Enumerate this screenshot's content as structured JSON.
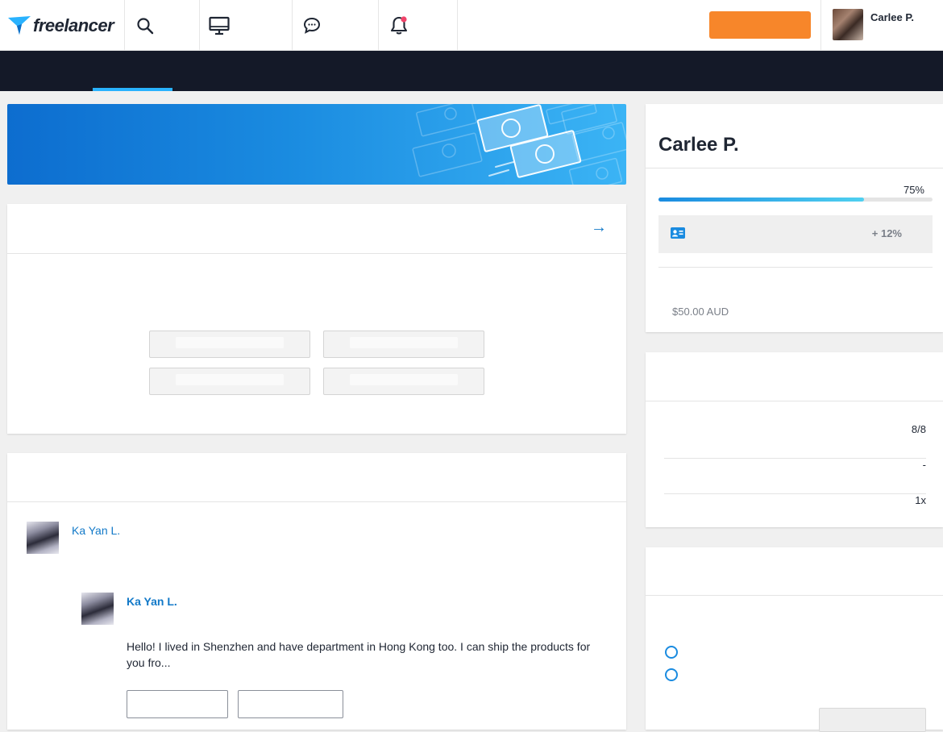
{
  "header": {
    "logo_text": "freelancer",
    "user": {
      "name": "Carlee P."
    },
    "notification_dot_color": "#f0436a",
    "post_button_color": "#f7862a"
  },
  "subnav": {
    "active_indicator_color": "#29b2fe"
  },
  "proposal": {
    "arrow": "→"
  },
  "bids": {
    "bidder_name": "Ka Yan L.",
    "reply_author": "Ka Yan L.",
    "reply_text": "Hello! I lived in Shenzhen and have department in Hong Kong too. I can ship the products for you fro..."
  },
  "profile": {
    "name": "Carlee P.",
    "progress_label": "75%",
    "progress_value": 0.75,
    "verify_gain": "+ 12%",
    "balance": "$50.00 AUD"
  },
  "stats": {
    "rows": [
      {
        "value": "8/8"
      },
      {
        "value": "-"
      },
      {
        "value": "1x"
      }
    ]
  },
  "icons": {
    "search": "search-icon",
    "dashboard": "monitor-icon",
    "messages": "chat-bubble-icon",
    "notifications": "bell-icon",
    "verify": "id-card-icon"
  }
}
